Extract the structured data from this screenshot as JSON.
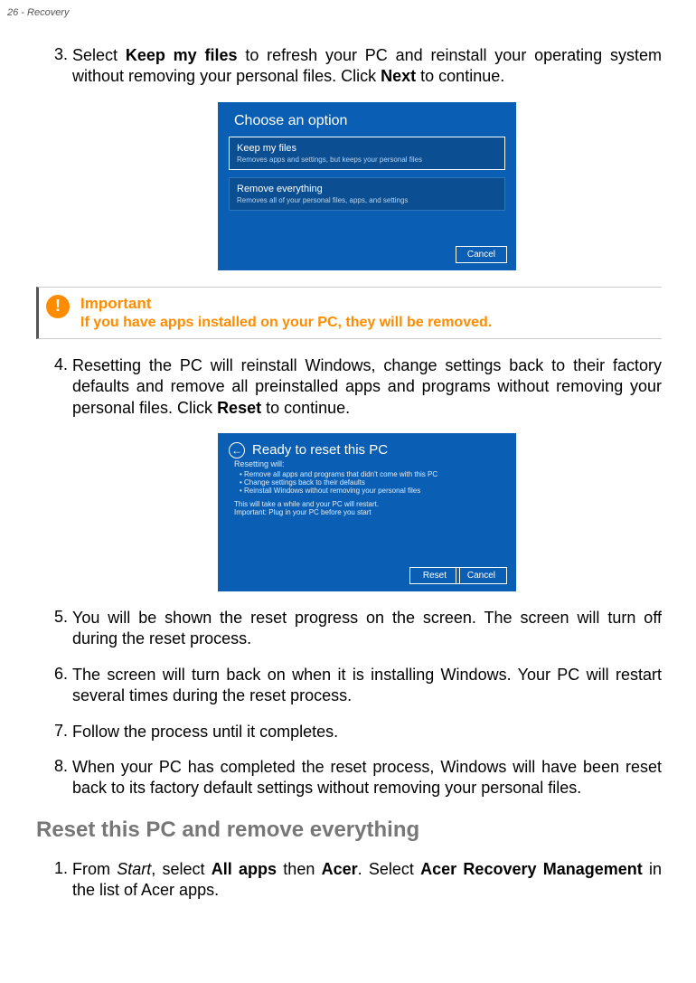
{
  "header": "26 - Recovery",
  "step3": {
    "num": "3.",
    "pre": "Select ",
    "b1": "Keep my files",
    "mid": " to refresh your PC and reinstall your operating system without removing your personal files. Click ",
    "b2": "Next",
    "post": " to continue."
  },
  "fig1": {
    "title": "Choose an option",
    "opt1_t": "Keep my files",
    "opt1_s": "Removes apps and settings, but keeps your personal files",
    "opt2_t": "Remove everything",
    "opt2_s": "Removes all of your personal files, apps, and settings",
    "cancel": "Cancel"
  },
  "important": {
    "title": "Important",
    "text": "If you have apps installed on your PC, they will be removed."
  },
  "step4": {
    "num": "4.",
    "pre": "Resetting the PC will reinstall Windows, change settings back to their factory defaults and remove all preinstalled apps and programs without removing your personal files. Click ",
    "b1": "Reset",
    "post": " to continue."
  },
  "fig2": {
    "title": "Ready to reset this PC",
    "hd": "Resetting will:",
    "li1": "Remove all apps and programs that didn't come with this PC",
    "li2": "Change settings back to their defaults",
    "li3": "Reinstall Windows without removing your personal files",
    "ex1": "This will take a while and your PC will restart.",
    "ex2": "Important: Plug in your PC before you start",
    "reset": "Reset",
    "cancel": "Cancel",
    "back": "←"
  },
  "step5": {
    "num": "5.",
    "text": "You will be shown the reset progress on the screen. The screen will turn off during the reset process."
  },
  "step6": {
    "num": "6.",
    "text": "The screen will turn back on when it is installing Windows. Your PC will restart several times during the reset process."
  },
  "step7": {
    "num": "7.",
    "text": "Follow the process until it completes."
  },
  "step8": {
    "num": "8.",
    "text": "When your PC has completed the reset process, Windows will have been reset back to its factory default settings without removing your personal files."
  },
  "section2": "Reset this PC and remove everything",
  "step2_1": {
    "num": "1.",
    "pre": "From ",
    "i1": "Start",
    "mid1": ", select ",
    "b1": "All apps",
    "mid2": " then ",
    "b2": "Acer",
    "mid3": ". Select ",
    "b3": "Acer Recovery Management",
    "post": " in the list of Acer apps."
  }
}
